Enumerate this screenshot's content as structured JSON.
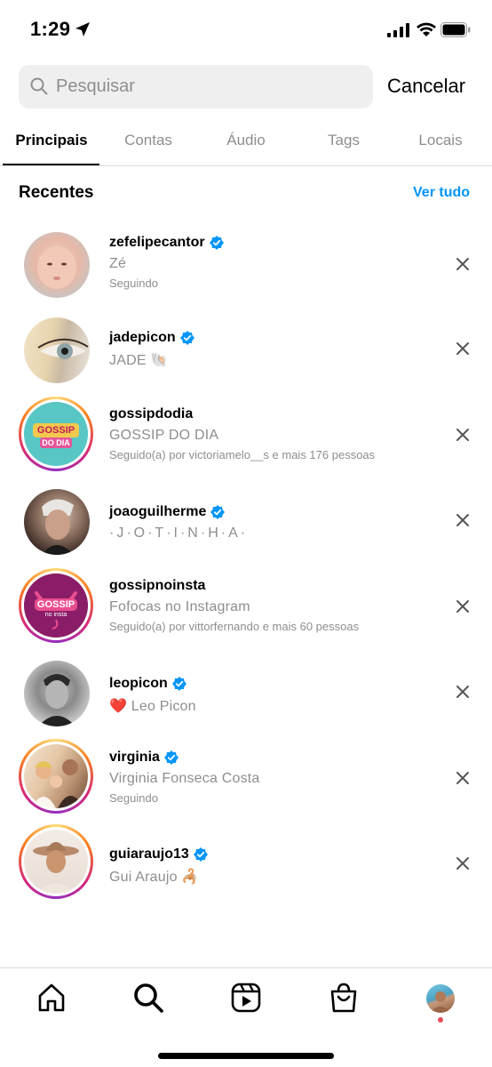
{
  "status_bar": {
    "time": "1:29"
  },
  "search": {
    "placeholder": "Pesquisar",
    "value": "",
    "cancel_label": "Cancelar"
  },
  "tabs": [
    {
      "label": "Principais",
      "active": true
    },
    {
      "label": "Contas"
    },
    {
      "label": "Áudio"
    },
    {
      "label": "Tags"
    },
    {
      "label": "Locais"
    }
  ],
  "recent": {
    "title": "Recentes",
    "see_all_label": "Ver tudo",
    "items": [
      {
        "username": "zefelipecantor",
        "verified": true,
        "fullname": "Zé",
        "subtext": "Seguindo",
        "ring": false
      },
      {
        "username": "jadepicon",
        "verified": true,
        "fullname": "JADE 🐚",
        "subtext": "",
        "ring": false
      },
      {
        "username": "gossipdodia",
        "verified": false,
        "fullname": "GOSSIP DO DIA",
        "subtext": "Seguido(a) por victoriamelo__s e mais 176 pessoas",
        "ring": true,
        "logo_text_top": "GOSSIP",
        "logo_text_bottom": "DO DIA"
      },
      {
        "username": "joaoguilherme",
        "verified": true,
        "fullname": "·J·O·T·I·N·H·A·",
        "subtext": "",
        "ring": false
      },
      {
        "username": "gossipnoinsta",
        "verified": false,
        "fullname": "Fofocas no Instagram",
        "subtext": "Seguido(a) por vittorfernando e mais 60 pessoas",
        "ring": true,
        "logo_text_top": "GOSSIP",
        "logo_text_bottom": "no insta"
      },
      {
        "username": "leopicon",
        "verified": true,
        "fullname": "❤️ Leo Picon",
        "subtext": "",
        "ring": false
      },
      {
        "username": "virginia",
        "verified": true,
        "fullname": "Virginia Fonseca Costa",
        "subtext": "Seguindo",
        "ring": true
      },
      {
        "username": "guiaraujo13",
        "verified": true,
        "fullname": "Gui Araujo 🦂",
        "subtext": "",
        "ring": true
      }
    ]
  },
  "bottom_nav": {
    "items": [
      "home-icon",
      "search-icon",
      "reels-icon",
      "shop-icon",
      "profile-avatar"
    ]
  },
  "colors": {
    "link": "#0095f6",
    "verified": "#0095f6",
    "muted": "#8e8e8e"
  }
}
